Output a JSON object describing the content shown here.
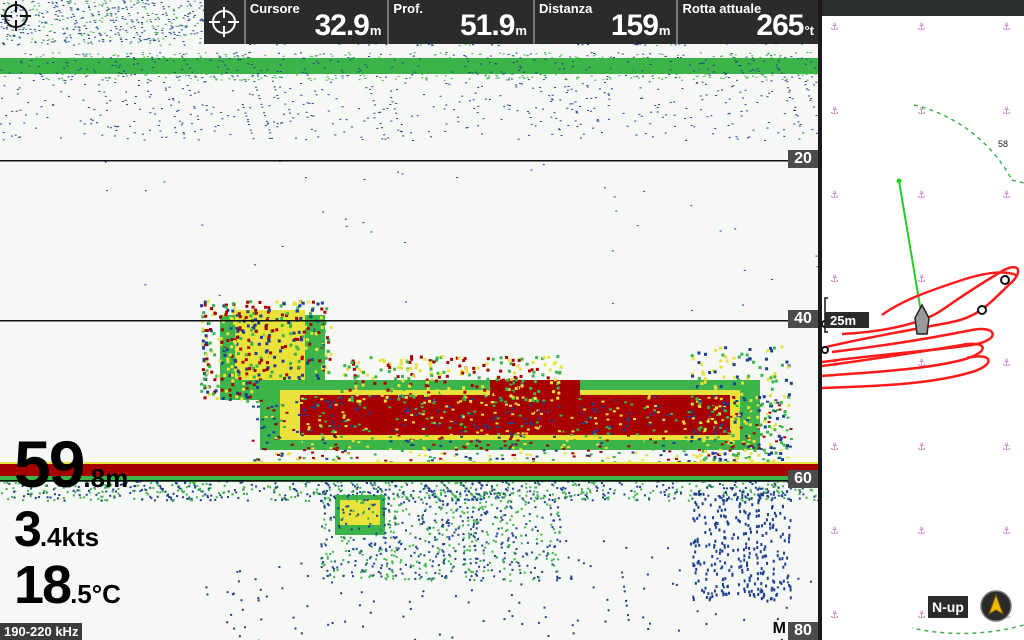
{
  "databar": {
    "cursor": {
      "label": "Cursore",
      "value": "32.9",
      "unit": "m"
    },
    "depth_field": {
      "label": "Prof.",
      "value": "51.9",
      "unit": "m"
    },
    "distance": {
      "label": "Distanza",
      "value": "159",
      "unit": "m"
    },
    "course": {
      "label": "Rotta attuale",
      "value": "265",
      "unit": "°t"
    }
  },
  "sonar": {
    "depth_scale": [
      "20",
      "40",
      "60",
      "80"
    ],
    "depth_value": "59",
    "depth_decimal": ".8m",
    "speed_value": "3",
    "speed_decimal": ".4kts",
    "temp_value": "18",
    "temp_decimal": ".5°C",
    "frequency": "190-220 kHz",
    "mode_letter": "M",
    "colors": {
      "background": "#f5f8f5",
      "weak": "#1d3f8f",
      "medium": "#3cb44a",
      "strong": "#e8e23a",
      "max": "#a80000"
    }
  },
  "chart": {
    "depth_marker": "58",
    "range_label": "25m",
    "orientation": "N-up",
    "colors": {
      "track": "#ff1a1a",
      "heading_line": "#22d022",
      "range_ring": "#3cb44a",
      "anchor_marks": "#c070c0"
    }
  }
}
